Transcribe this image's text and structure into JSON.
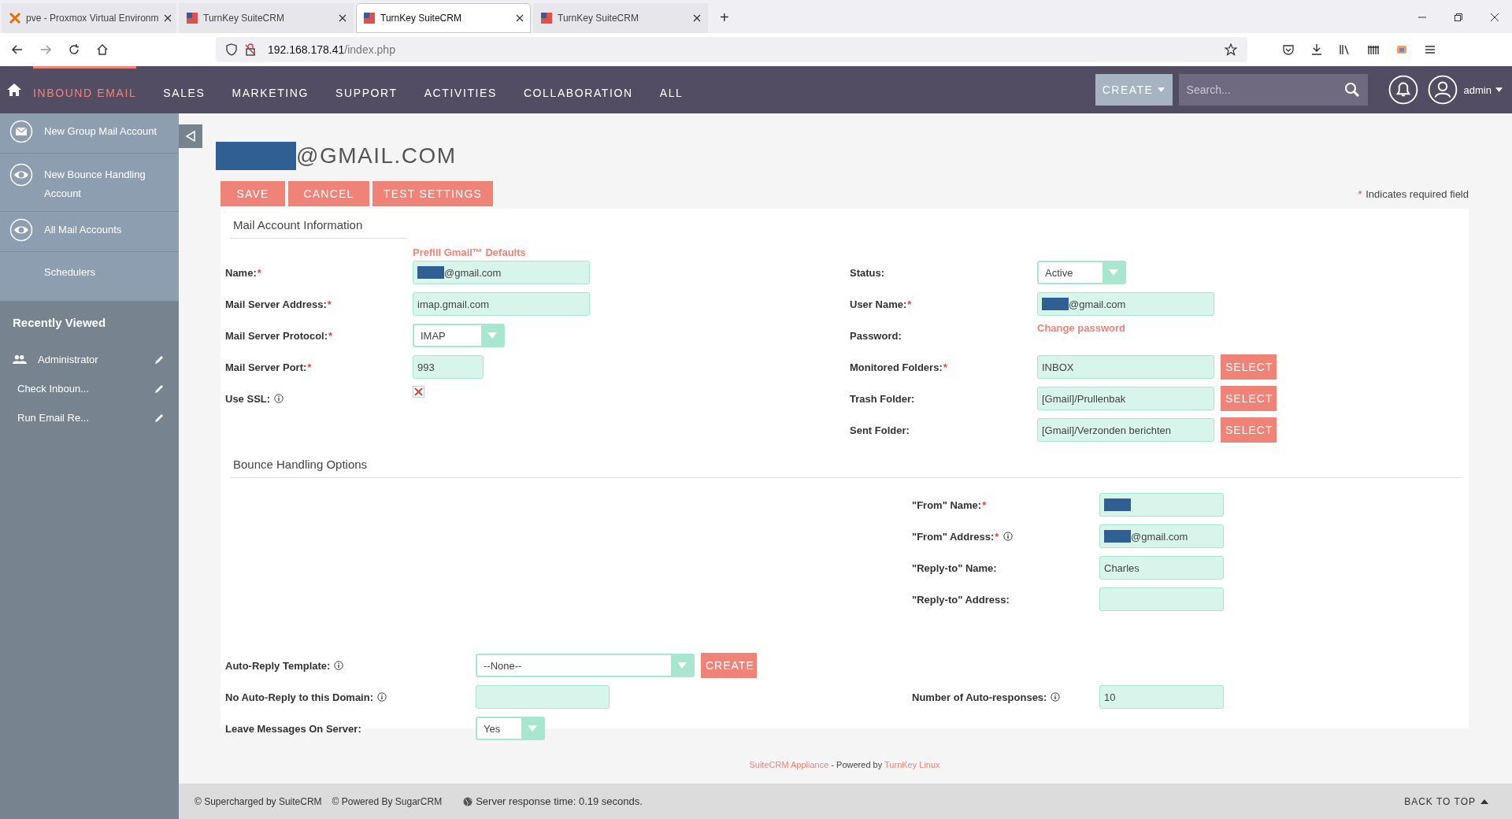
{
  "browser": {
    "tabs": [
      {
        "title": "pve - Proxmox Virtual Environm",
        "kind": "proxmox",
        "selected": false
      },
      {
        "title": "TurnKey SuiteCRM",
        "kind": "suite",
        "selected": false
      },
      {
        "title": "TurnKey SuiteCRM",
        "kind": "suite",
        "selected": true
      },
      {
        "title": "TurnKey SuiteCRM",
        "kind": "suite",
        "selected": false
      }
    ],
    "new_tab": "+",
    "url_host": "192.168.178.41",
    "url_path": "/index.php"
  },
  "nav": {
    "items": [
      {
        "label": "INBOUND EMAIL",
        "selected": true
      },
      {
        "label": "SALES",
        "selected": false
      },
      {
        "label": "MARKETING",
        "selected": false
      },
      {
        "label": "SUPPORT",
        "selected": false
      },
      {
        "label": "ACTIVITIES",
        "selected": false
      },
      {
        "label": "COLLABORATION",
        "selected": false
      },
      {
        "label": "ALL",
        "selected": false
      }
    ],
    "create": "CREATE",
    "search": {
      "placeholder": "Search..."
    },
    "user": "admin"
  },
  "sidebar": {
    "actions": [
      {
        "label": "New Group Mail Account"
      },
      {
        "label": "New Bounce Handling Account"
      },
      {
        "label": "All Mail Accounts"
      },
      {
        "label": "Schedulers"
      }
    ],
    "recent_title": "Recently Viewed",
    "recent": [
      {
        "label": "Administrator"
      },
      {
        "label": "Check Inboun..."
      },
      {
        "label": "Run Email Re..."
      }
    ]
  },
  "page": {
    "title": "@GMAIL.COM",
    "title_redacted": true,
    "buttons": [
      "SAVE",
      "CANCEL",
      "TEST SETTINGS"
    ],
    "required_mark": "*",
    "required_note": "Indicates required field"
  },
  "mail": {
    "title": "Mail Account Information",
    "prefill": "Prefill Gmail™ Defaults",
    "rows": [
      {
        "left": {
          "label": "Name:",
          "required": "*",
          "kind": "text",
          "value": "@gmail.com",
          "redacted": true
        },
        "right": {
          "label": "Status:",
          "kind": "select",
          "value": "Active"
        }
      },
      {
        "left": {
          "label": "Mail Server Address:",
          "required": "*",
          "kind": "text",
          "value": "imap.gmail.com"
        },
        "right": {
          "label": "User Name:",
          "required": "*",
          "kind": "text",
          "value": "@gmail.com",
          "redacted": true
        }
      },
      {
        "left": {
          "label": "Mail Server Protocol:",
          "required": "*",
          "kind": "select",
          "value": "IMAP"
        },
        "right": {
          "label": "Password:",
          "kind": "link",
          "value": "Change password"
        }
      },
      {
        "left": {
          "label": "Mail Server Port:",
          "required": "*",
          "kind": "text",
          "value": "993"
        },
        "right": {
          "label": "Monitored Folders:",
          "required": "*",
          "kind": "text",
          "value": "INBOX",
          "button": "SELECT"
        }
      },
      {
        "left": {
          "label": "Use SSL:",
          "info": true,
          "kind": "checkbox",
          "checked": true
        },
        "right": {
          "label": "Trash Folder:",
          "kind": "text",
          "value": "[Gmail]/Prullenbak",
          "button": "SELECT"
        }
      },
      {
        "right": {
          "label": "Sent Folder:",
          "kind": "text",
          "value": "[Gmail]/Verzonden berichten",
          "button": "SELECT"
        }
      }
    ]
  },
  "bounce": {
    "title": "Bounce Handling Options",
    "rows": [
      {
        "right": {
          "label": "\"From\" Name:",
          "required": "*",
          "kind": "text",
          "redacted": true
        }
      },
      {
        "right": {
          "label": "\"From\" Address:",
          "required": "*",
          "info": true,
          "kind": "text",
          "value": "@gmail.com",
          "redacted": true
        }
      },
      {
        "right": {
          "label": "\"Reply-to\" Name:",
          "kind": "text",
          "value": "Charles"
        }
      },
      {
        "right": {
          "label": "\"Reply-to\" Address:",
          "kind": "text"
        }
      }
    ]
  },
  "options": {
    "rows": [
      {
        "left": {
          "label": "Auto-Reply Template:",
          "info": true,
          "kind": "select",
          "value": "--None--",
          "button": "CREATE"
        }
      },
      {
        "left": {
          "label": "No Auto-Reply to this Domain:",
          "info": true,
          "kind": "text"
        },
        "right": {
          "label": "Number of Auto-responses:",
          "info": true,
          "kind": "text",
          "value": "10"
        }
      },
      {
        "left": {
          "label": "Leave Messages On Server:",
          "kind": "select",
          "value": "Yes"
        }
      }
    ]
  },
  "footer": {
    "appliance": "SuiteCRM Appliance",
    "powered": " - Powered by ",
    "turnkey": "TurnKey Linux",
    "supercharged": "© Supercharged by SuiteCRM",
    "sugar": "© Powered By SugarCRM",
    "response": "Server response time: 0.19 seconds.",
    "back_to_top": "BACK TO TOP"
  }
}
